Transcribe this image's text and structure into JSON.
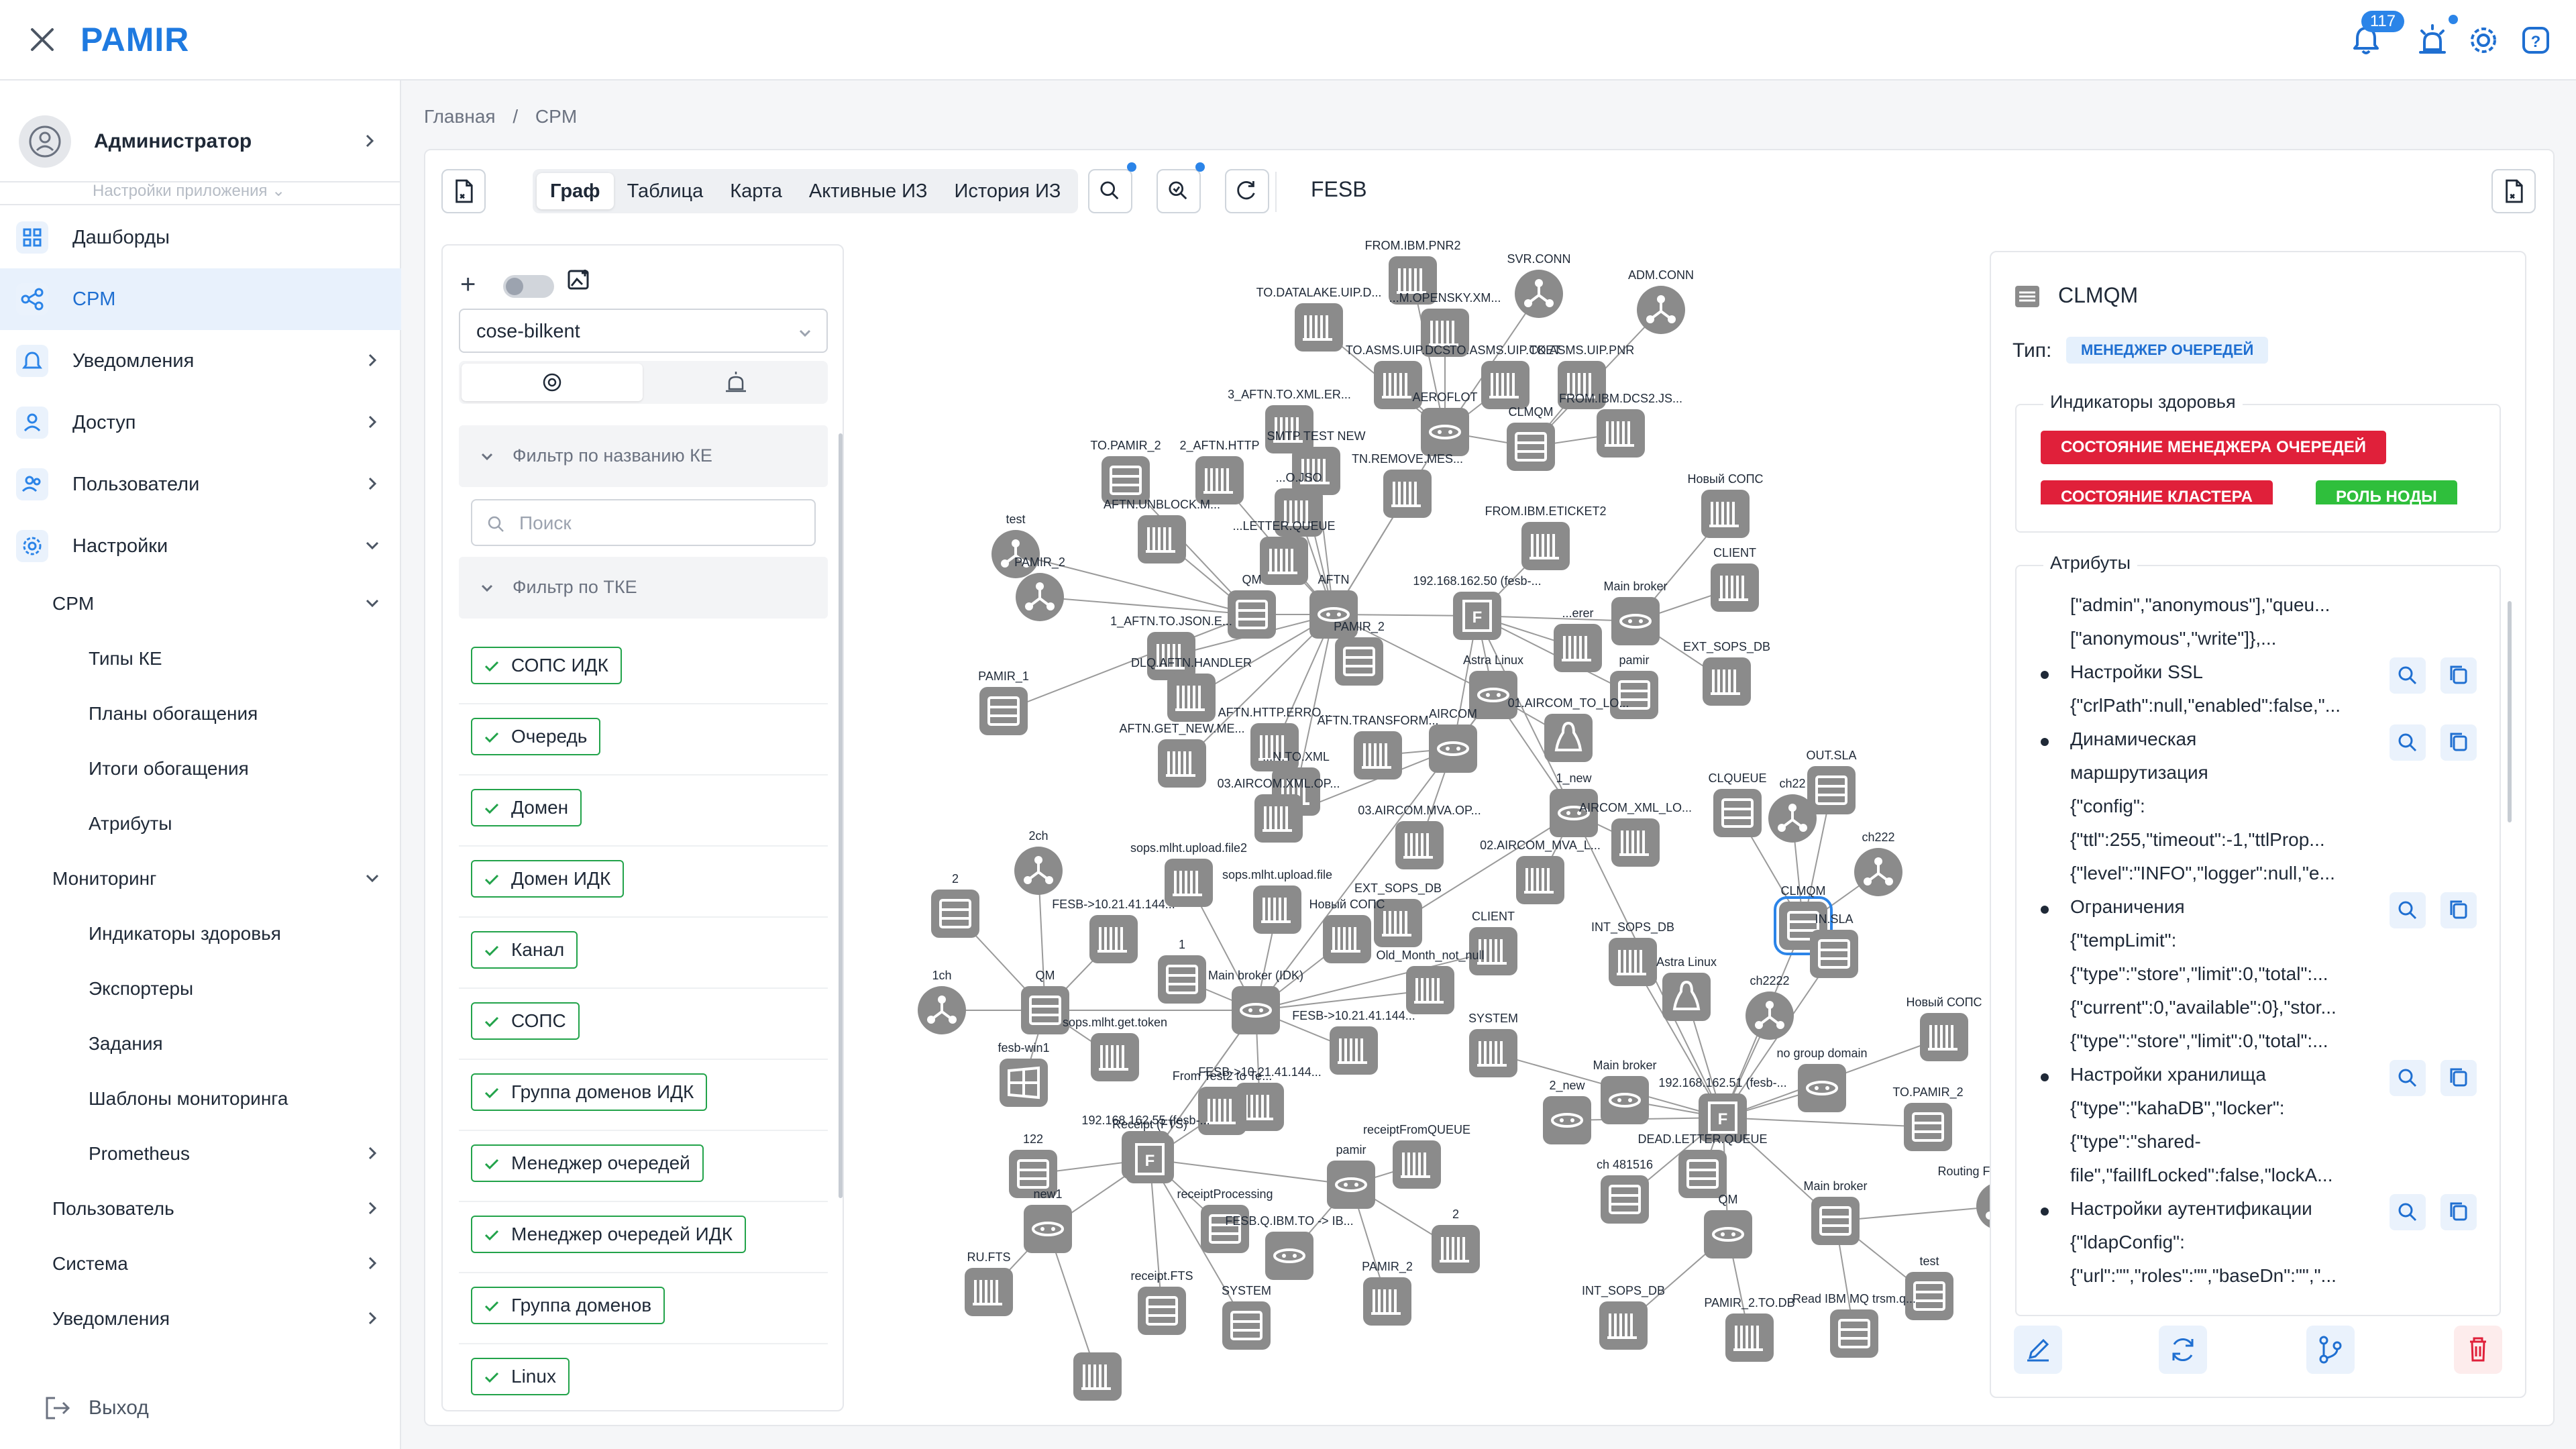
{
  "header": {
    "brand": "PAMIR",
    "notifications_count": "117",
    "icons": [
      "close-icon",
      "bell-icon",
      "alarm-icon",
      "gear-icon",
      "help-icon"
    ]
  },
  "sidebar": {
    "user_name": "Администратор",
    "app_settings_label": "Настройки приложения",
    "items": [
      {
        "label": "Дашборды"
      },
      {
        "label": "CPM"
      },
      {
        "label": "Уведомления"
      },
      {
        "label": "Доступ"
      },
      {
        "label": "Пользователи"
      },
      {
        "label": "Настройки"
      }
    ],
    "settings_sub": {
      "cpm": "CPM",
      "cpm_children": [
        "Типы КЕ",
        "Планы обогащения",
        "Итоги обогащения",
        "Атрибуты"
      ],
      "monitoring": "Мониторинг",
      "monitoring_children": [
        "Индикаторы здоровья",
        "Экспортеры",
        "Задания",
        "Шаблоны мониторинга",
        "Prometheus"
      ],
      "user": "Пользователь",
      "system": "Система",
      "notifications": "Уведомления"
    },
    "logout": "Выход"
  },
  "breadcrumb": [
    "Главная",
    "/",
    "CPM"
  ],
  "toolbar": {
    "tabs": [
      "Граф",
      "Таблица",
      "Карта",
      "Активные ИЗ",
      "История ИЗ"
    ],
    "active_tab": "Граф",
    "context_label": "FESB"
  },
  "filters": {
    "layout_value": "cose-bilkent",
    "name_filter_label": "Фильтр по названию КЕ",
    "search_placeholder": "Поиск",
    "tke_filter_label": "Фильтр по ТКЕ",
    "chips": [
      "СОПС ИДК",
      "Очередь",
      "Домен",
      "Домен ИДК",
      "Канал",
      "СОПС",
      "Группа доменов ИДК",
      "Менеджер очередей",
      "Менеджер очередей ИДК",
      "Группа доменов",
      "Linux"
    ]
  },
  "graph": {
    "labels": [
      "FROM.IBM.PNR2",
      "SVR.CONN",
      "ADM.CONN",
      "TO.DATALAKE.UIP.D...",
      "...M.OPENSKY.XM...",
      "TO.ASMS.UIP.DCS",
      "TO.ASMS.UIP.CKET",
      "TO.ASMS.UIP.PNR",
      "3_AFTN.TO.XML.ER...",
      "AEROFLOT",
      "CLMQM",
      "FROM.IBM.DCS2.JS...",
      "TO.PAMIR_2",
      "2_AFTN.HTTP",
      "SMTP TEST NEW",
      "TN.REMOVE.MES...",
      "Новый СОПС",
      "test",
      "AFTN.UNBLOCK.M...",
      "...O.JSO",
      "FROM.IBM.ETICKET2",
      "PAMIR_2",
      "...LETTER.QUEUE",
      "QM",
      "AFTN",
      "192.168.162.50 (fesb-...",
      "Main broker",
      "CLIENT",
      "1_AFTN.TO.JSON.E...",
      "PAMIR_2",
      "...erer",
      "pamir",
      "EXT_SOPS_DB",
      "PAMIR_1",
      "DLQ.AFTN.HANDLER",
      "Astra Linux",
      "AFTN.GET_NEW.ME...",
      "AFTN.HTTP.ERRO...",
      "AFTN.TRANSFORM...",
      "AIRCOM",
      "01.AIRCOM_TO_LO...",
      "...N.TO.XML",
      "1_new",
      "03.AIRCOM.XML.OP...",
      "03.AIRCOM.MVA.OP...",
      "AIRCOM_XML_LO...",
      "CLQUEUE",
      "OUT.SLA",
      "ch22",
      "ch222",
      "2ch",
      "sops.mlht.upload.file2",
      "sops.mlht.upload.file",
      "EXT_SOPS_DB",
      "02.AIRCOM_MVA_L...",
      "2",
      "FESB->10.21.41.144...",
      "Новый СОПС",
      "CLIENT",
      "CLMQM",
      "IN.SLA",
      "INT_SOPS_DB",
      "1",
      "Old_Month_not_null",
      "1ch",
      "QM",
      "Main broker (IDK)",
      "Astra Linux",
      "ch2222",
      "sops.mlht.get.token",
      "FESB->10.21.41.144...",
      "SYSTEM",
      "Main broker",
      "no group domain",
      "Новый СОПС",
      "fesb-win1",
      "FESB->10.21.41.144...",
      "From Test2 to Te...",
      "2_new",
      "192.168.162.51 (fesb-...",
      "TO.PAMIR_2",
      "192.168.162.55 (fesb-...",
      "receiptFromQUEUE",
      "DEAD.LETTER.QUEUE",
      "122",
      "Receipt (FTS)",
      "pamir",
      "ch 481516",
      "Routing FESB-IBM (F...",
      "new1",
      "receiptProcessing",
      "2",
      "QM",
      "Main broker",
      "FESB.Q.IBM.TO -> IB...",
      "RU.FTS",
      "receipt.FTS",
      "PAMIR_2",
      "test",
      "SYSTEM",
      "INT_SOPS_DB",
      "PAMIR_2.TO.DB",
      "Read IBM MQ trsm.q..."
    ]
  },
  "details": {
    "title": "CLMQM",
    "type_label": "Тип:",
    "type_value": "МЕНЕДЖЕР ОЧЕРЕДЕЙ",
    "health_label": "Индикаторы здоровья",
    "health_badges": [
      "СОСТОЯНИЕ МЕНЕДЖЕРА ОЧЕРЕДЕЙ",
      "СОСТОЯНИЕ КЛАСТЕРА",
      "РОЛЬ НОДЫ"
    ],
    "health_colors": [
      "#e0203a",
      "#e0203a",
      "#2fbf3c"
    ],
    "attrs_label": "Атрибуты",
    "attr_lines": [
      "[\"admin\",\"anonymous\"],\"queu...",
      "[\"anonymous\",\"write\"]},...",
      "Настройки SSL",
      "{\"crlPath\":null,\"enabled\":false,\"...",
      "Динамическая",
      "маршрутизация",
      "{\"config\":",
      "{\"ttl\":255,\"timeout\":-1,\"ttlProp...",
      "{\"level\":\"INFO\",\"logger\":null,\"e...",
      "Ограничения",
      "{\"tempLimit\":",
      "{\"type\":\"store\",\"limit\":0,\"total\":...",
      "{\"current\":0,\"available\":0},\"stor...",
      "{\"type\":\"store\",\"limit\":0,\"total\":...",
      "Настройки хранилища",
      "{\"type\":\"kahaDB\",\"locker\":",
      "{\"type\":\"shared-",
      "file\",\"failIfLocked\":false,\"lockA...",
      "Настройки аутентификации",
      "{\"ldapConfig\":",
      "{\"url\":\"\",\"roles\":\"\",\"baseDn\":\"\",\"..."
    ]
  }
}
